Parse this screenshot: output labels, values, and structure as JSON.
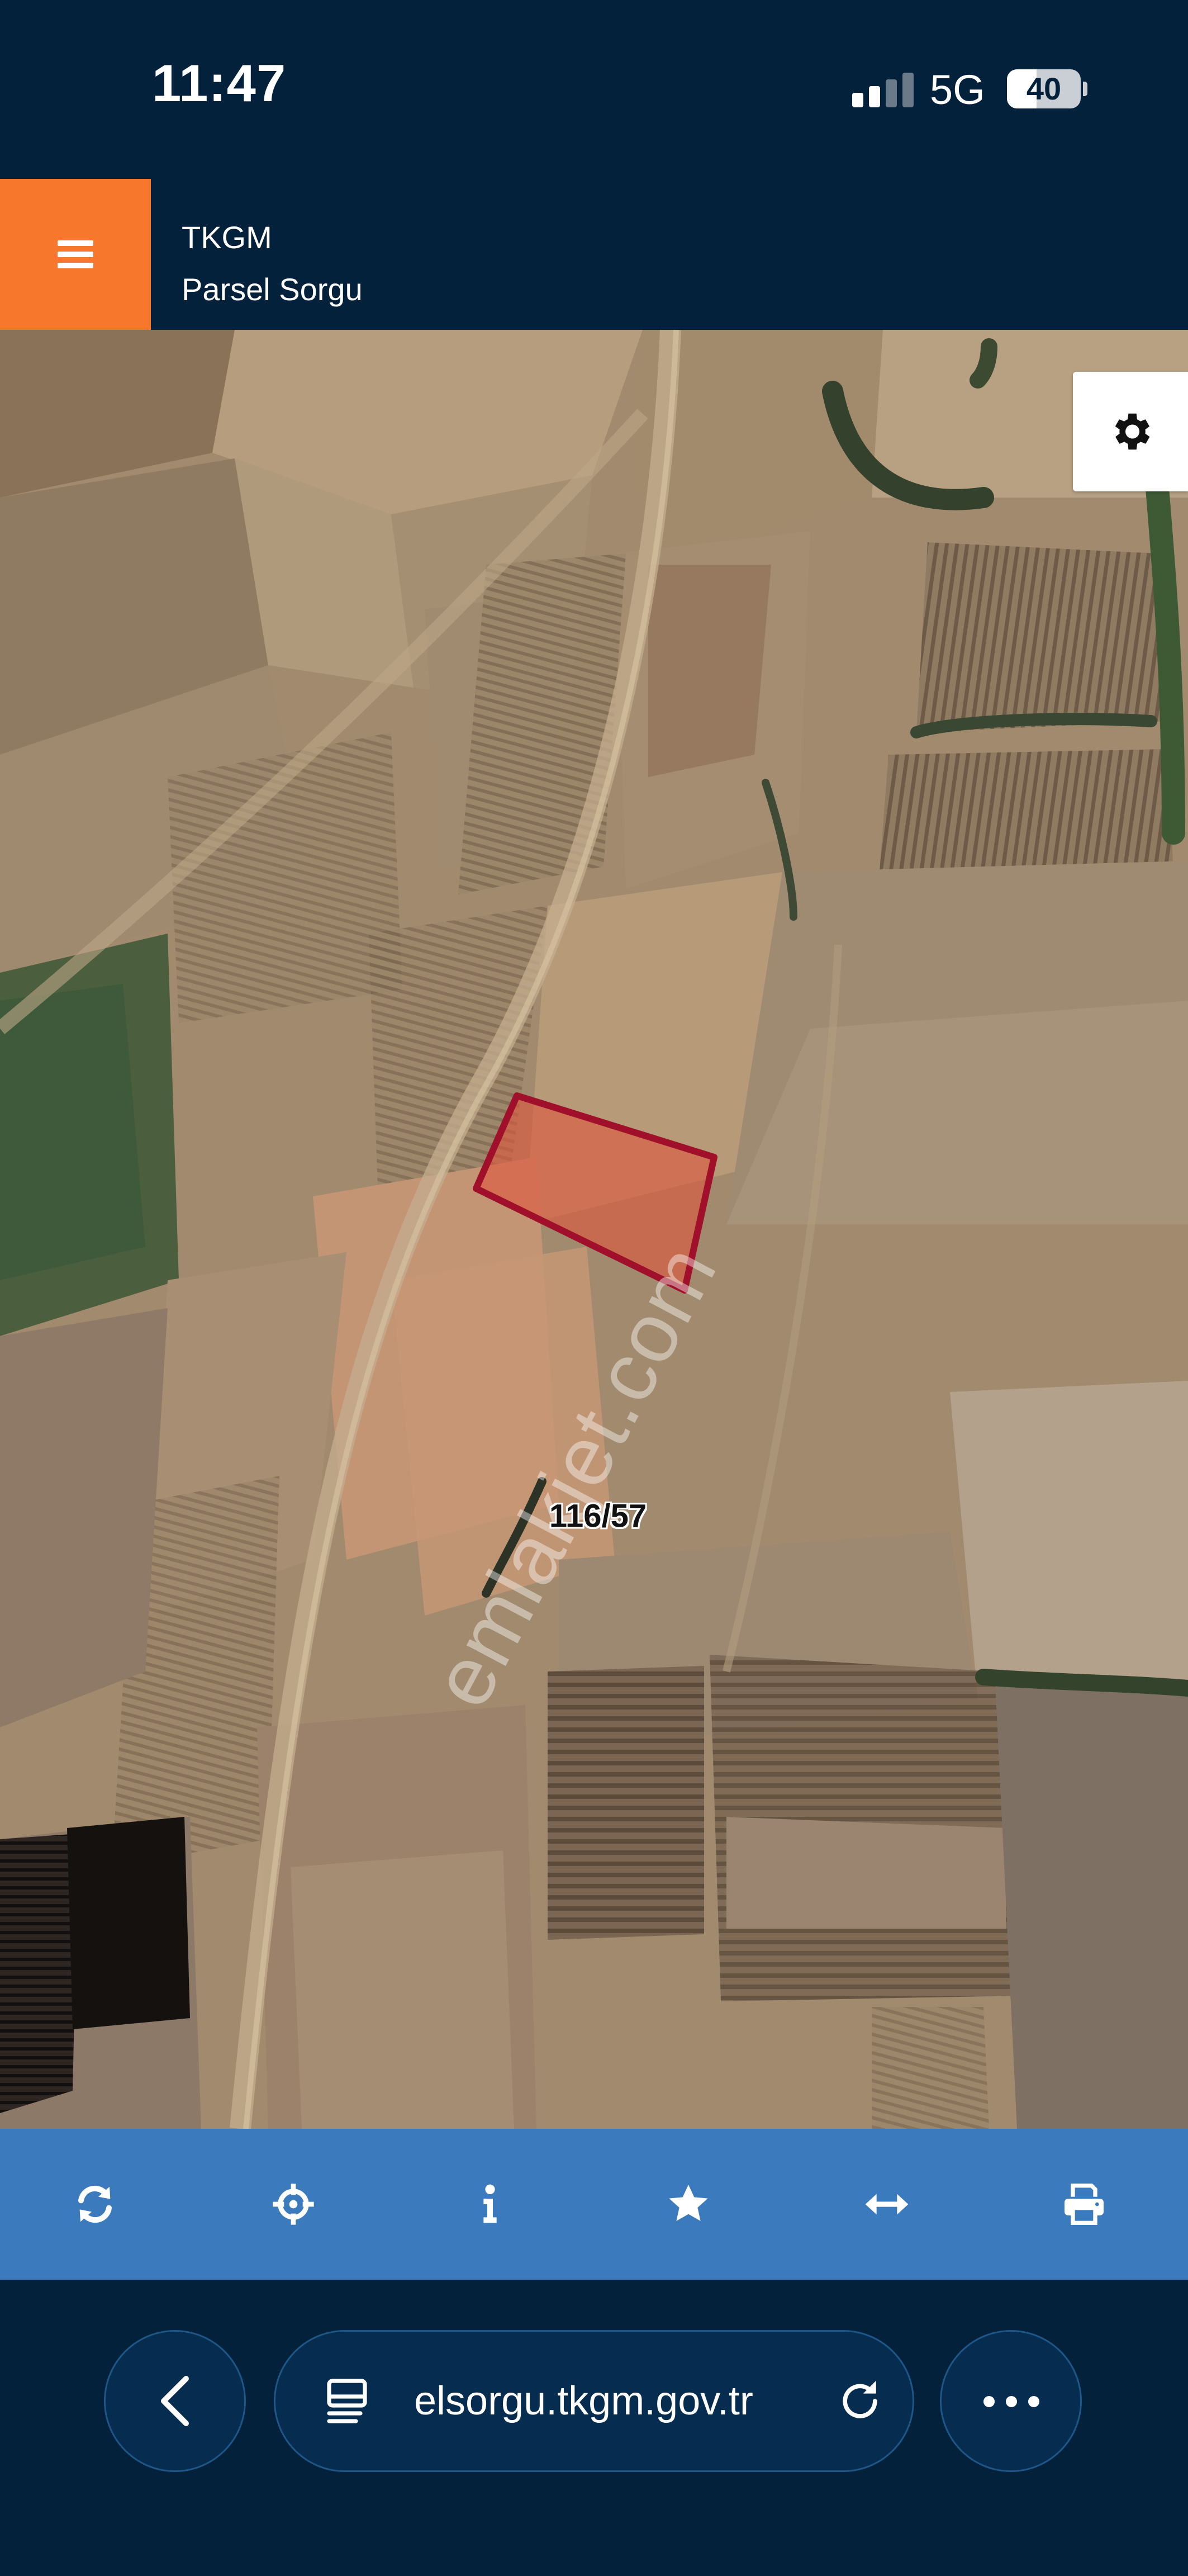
{
  "status_bar": {
    "time": "11:47",
    "network": "5G",
    "battery": "40",
    "battery_level": 0.4,
    "signal_bars_active": 2
  },
  "app_header": {
    "menu_icon": "hamburger-menu-icon",
    "title": "TKGM",
    "subtitle": "Parsel Sorgu",
    "accent_color": "#f7772d",
    "background_color": "#03213a"
  },
  "map": {
    "type": "satellite",
    "settings_icon": "gear-icon",
    "parcel": {
      "label": "116/57",
      "border_color": "#a0102a",
      "fill_color": "#e0573e"
    },
    "watermark": "emlakjet.com"
  },
  "toolbar": {
    "background_color": "#3b7bbd",
    "tools": [
      {
        "name": "refresh",
        "icon": "refresh-icon"
      },
      {
        "name": "locate",
        "icon": "crosshair-icon"
      },
      {
        "name": "info",
        "icon": "info-icon"
      },
      {
        "name": "favorite",
        "icon": "star-icon"
      },
      {
        "name": "measure",
        "icon": "horizontal-arrows-icon"
      },
      {
        "name": "print",
        "icon": "printer-icon"
      }
    ]
  },
  "browser_bar": {
    "url": "elsorgu.tkgm.gov.tr",
    "back_icon": "chevron-left-icon",
    "tabs_icon": "page-menu-icon",
    "reload_icon": "reload-icon",
    "more_icon": "more-dots-icon"
  }
}
